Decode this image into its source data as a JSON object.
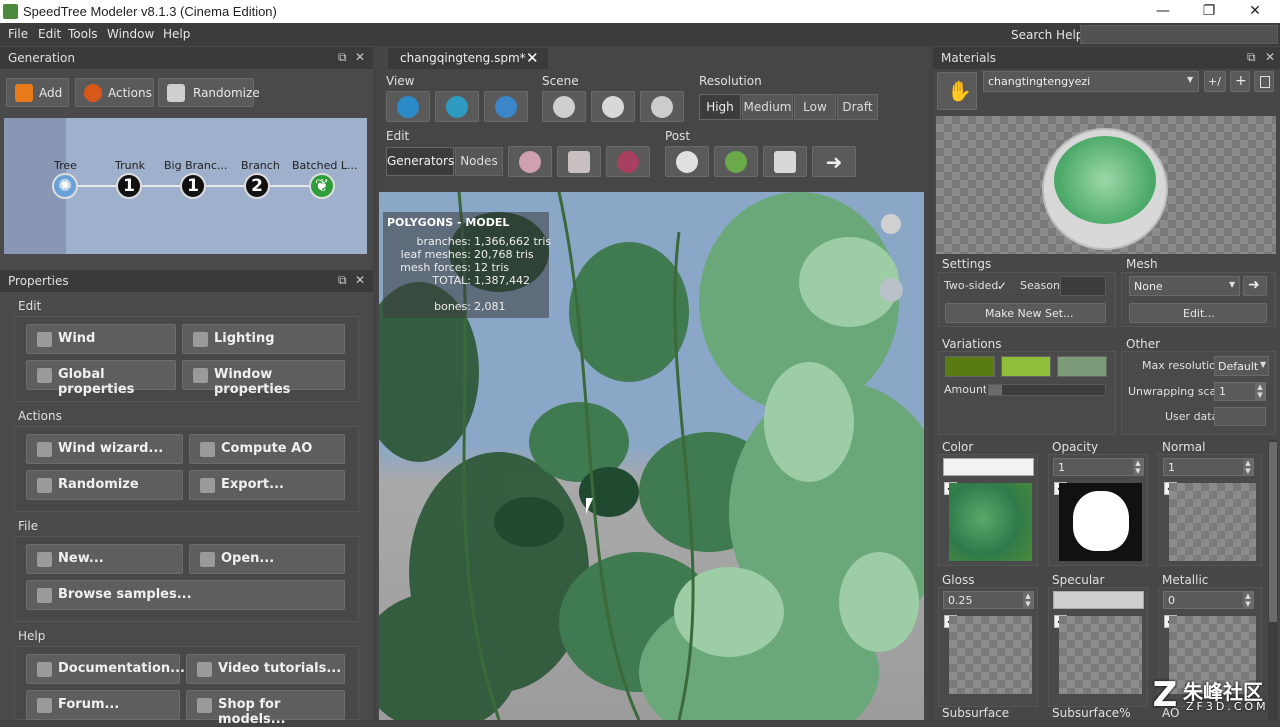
{
  "window": {
    "title": "SpeedTree Modeler v8.1.3 (Cinema Edition)",
    "controls": [
      "—",
      "❐",
      "✕"
    ]
  },
  "menu": [
    "File",
    "Edit",
    "Tools",
    "Window",
    "Help"
  ],
  "search_help": {
    "label": "Search Help:",
    "value": ""
  },
  "generation": {
    "title": "Generation",
    "toolbar": [
      {
        "label": "Add",
        "icon": "plus-icon"
      },
      {
        "label": "Actions",
        "icon": "actions-icon"
      },
      {
        "label": "Randomize",
        "icon": "dice-icon"
      }
    ],
    "nodes": [
      {
        "label": "Tree",
        "value": "",
        "icon": "tree-icon"
      },
      {
        "label": "Trunk",
        "value": "1"
      },
      {
        "label": "Big Branc...",
        "value": "1"
      },
      {
        "label": "Branch",
        "value": "2"
      },
      {
        "label": "Batched L...",
        "value": "",
        "icon": "leaves-icon"
      }
    ]
  },
  "properties": {
    "title": "Properties",
    "groups": [
      {
        "label": "Edit",
        "buttons": [
          {
            "label": "Wind",
            "icon": "wind-icon"
          },
          {
            "label": "Lighting",
            "icon": "lighting-icon"
          },
          {
            "label": "Global properties",
            "icon": "globe-icon"
          },
          {
            "label": "Window properties",
            "icon": "window-icon"
          }
        ]
      },
      {
        "label": "Actions",
        "buttons": [
          {
            "label": "Wind wizard...",
            "icon": "wizard-icon"
          },
          {
            "label": "Compute AO",
            "icon": "ao-icon"
          },
          {
            "label": "Randomize",
            "icon": "dice-icon"
          },
          {
            "label": "Export...",
            "icon": "export-icon"
          }
        ]
      },
      {
        "label": "File",
        "buttons": [
          {
            "label": "New...",
            "icon": "new-file-icon"
          },
          {
            "label": "Open...",
            "icon": "open-file-icon"
          },
          {
            "label": "Browse samples...",
            "icon": "search-icon"
          }
        ]
      },
      {
        "label": "Help",
        "buttons": [
          {
            "label": "Documentation...",
            "icon": "docs-icon"
          },
          {
            "label": "Video tutorials...",
            "icon": "video-icon"
          },
          {
            "label": "Forum...",
            "icon": "forum-icon"
          },
          {
            "label": "Shop for models...",
            "icon": "shop-icon"
          }
        ]
      }
    ]
  },
  "document": {
    "tab": "changqingteng.spm*",
    "view_label": "View",
    "scene_label": "Scene",
    "resolution_label": "Resolution",
    "resolution": [
      "High",
      "Medium",
      "Low",
      "Draft"
    ],
    "resolution_selected": "High",
    "edit_label": "Edit",
    "edit_modes": [
      "Generators",
      "Nodes"
    ],
    "edit_selected": "Generators",
    "post_label": "Post"
  },
  "stats": {
    "heading": "POLYGONS - MODEL",
    "rows": [
      {
        "label": "branches:",
        "value": "1,366,662 tris"
      },
      {
        "label": "leaf meshes:",
        "value": "20,768 tris"
      },
      {
        "label": "mesh forces:",
        "value": "12 tris"
      },
      {
        "label": "TOTAL:",
        "value": "1,387,442"
      },
      {
        "label": "bones:",
        "value": "2,081"
      }
    ]
  },
  "materials": {
    "title": "Materials",
    "selected": "changtingtengyezi",
    "settings_label": "Settings",
    "two_sided_label": "Two-sided",
    "season_label": "Season",
    "make_new_set": "Make New Set...",
    "mesh_label": "Mesh",
    "mesh_value": "None",
    "mesh_edit": "Edit...",
    "variations_label": "Variations",
    "variation_colors": [
      "#5a7a12",
      "#8fbf3a",
      "#7a9a78"
    ],
    "amount_label": "Amount",
    "other_label": "Other",
    "max_resolution_label": "Max resolution",
    "max_resolution_value": "Default",
    "unwrapping_scale_label": "Unwrapping scale",
    "unwrapping_scale_value": "1",
    "user_data_label": "User data",
    "maps": [
      {
        "label": "Color",
        "value": ""
      },
      {
        "label": "Opacity",
        "value": "1"
      },
      {
        "label": "Normal",
        "value": "1"
      },
      {
        "label": "Gloss",
        "value": "0.25"
      },
      {
        "label": "Specular",
        "value": ""
      },
      {
        "label": "Metallic",
        "value": "0"
      }
    ],
    "bottom_labels": [
      "Subsurface",
      "Subsurface%",
      "AO"
    ]
  },
  "watermark": {
    "brand": "朱峰社区",
    "site": "ZF3D.COM"
  }
}
